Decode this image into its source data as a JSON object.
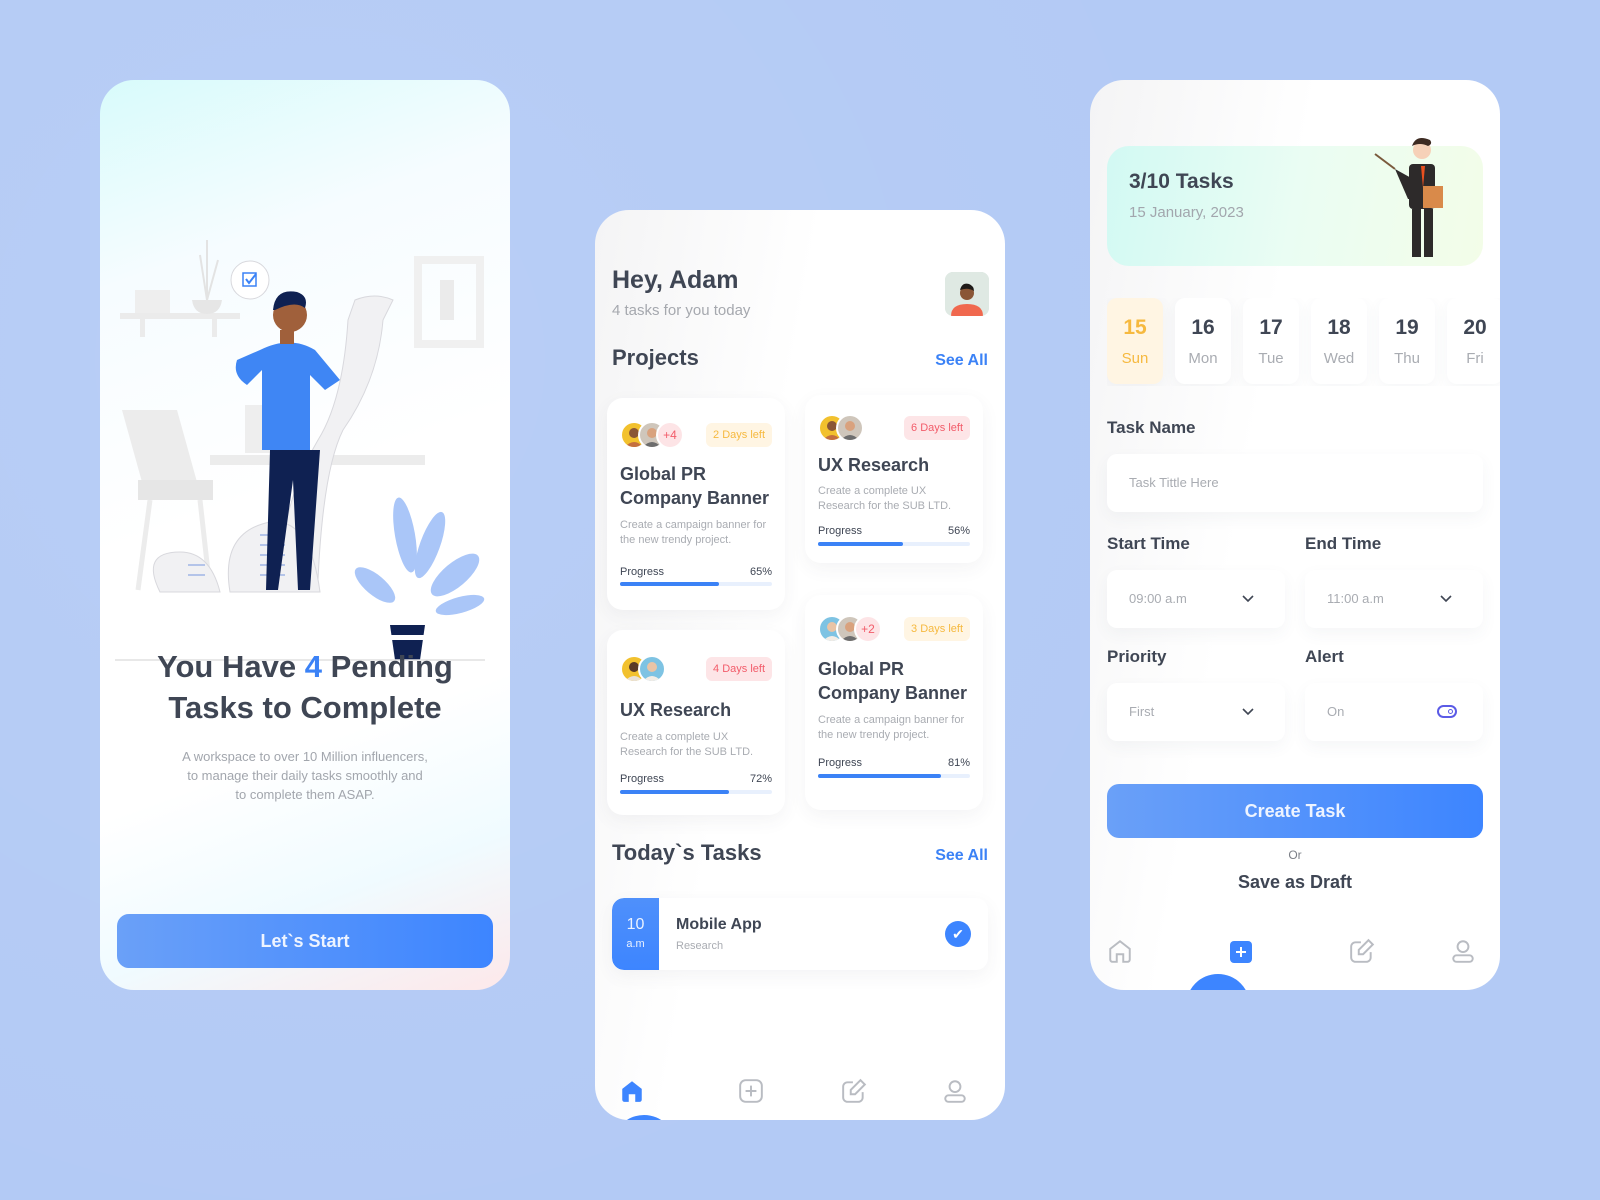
{
  "onboarding": {
    "title_prefix": "You Have",
    "pending_count": "4",
    "title_suffix_line1": "Pending",
    "title_line2": "Tasks to Complete",
    "subtitle_line1": "A workspace to over 10 Million influencers,",
    "subtitle_line2": "to manage their daily tasks smoothly and",
    "subtitle_line3": "to complete them ASAP.",
    "start_button": "Let`s Start",
    "illustration": "person-reading-task-list-illustration"
  },
  "home": {
    "greeting": "Hey, Adam",
    "tasks_today": "4 tasks for you today",
    "projects_title": "Projects",
    "projects_see_all": "See All",
    "projects": [
      {
        "title": "Global PR Company Banner",
        "description": "Create a campaign banner for the new trendy project.",
        "deadline": "2 Days left",
        "deadline_color": "#f6b93f",
        "extra_members": "+4",
        "progress_label": "Progress",
        "progress": 65,
        "progress_text": "65%"
      },
      {
        "title": "UX Research",
        "description": "Create a complete UX Research for the SUB LTD.",
        "deadline": "6 Days left",
        "deadline_color": "#f25c6a",
        "extra_members": "",
        "progress_label": "Progress",
        "progress": 56,
        "progress_text": "56%"
      },
      {
        "title": "UX Research",
        "description": "Create a complete UX Research for the SUB LTD.",
        "deadline": "4 Days left",
        "deadline_color": "#f25c6a",
        "extra_members": "",
        "progress_label": "Progress",
        "progress": 72,
        "progress_text": "72%"
      },
      {
        "title": "Global PR Company Banner",
        "description": "Create a campaign banner for the new trendy project.",
        "deadline": "3 Days left",
        "deadline_color": "#f6b93f",
        "extra_members": "+2",
        "progress_label": "Progress",
        "progress": 81,
        "progress_text": "81%"
      }
    ],
    "today_title": "Today`s Tasks",
    "today_see_all": "See All",
    "tasks": [
      {
        "hour": "10",
        "meridiem": "a.m",
        "name": "Mobile App",
        "category": "Research",
        "done": true
      }
    ],
    "nav": [
      "home-icon",
      "add-icon",
      "edit-icon",
      "profile-icon"
    ],
    "nav_active": "home-icon"
  },
  "create": {
    "summary": "3/10 Tasks",
    "date": "15 January, 2023",
    "days": [
      {
        "num": "15",
        "name": "Sun",
        "selected": true
      },
      {
        "num": "16",
        "name": "Mon"
      },
      {
        "num": "17",
        "name": "Tue"
      },
      {
        "num": "18",
        "name": "Wed"
      },
      {
        "num": "19",
        "name": "Thu"
      },
      {
        "num": "20",
        "name": "Fri"
      }
    ],
    "task_name_label": "Task Name",
    "task_name_placeholder": "Task Tittle Here",
    "start_label": "Start Time",
    "start_value": "09:00 a.m",
    "end_label": "End Time",
    "end_value": "11:00 a.m",
    "priority_label": "Priority",
    "priority_value": "First",
    "alert_label": "Alert",
    "alert_value": "On",
    "alert_on": true,
    "create_button": "Create Task",
    "or_text": "Or",
    "draft_button": "Save as Draft",
    "nav": [
      "home-icon",
      "add-icon",
      "edit-icon",
      "profile-icon"
    ],
    "nav_active": "add-icon"
  },
  "colors": {
    "accent": "#3d85ff",
    "warning": "#f6b93f",
    "danger": "#f25c6a",
    "text": "#3f4654",
    "muted": "#a9acb2"
  }
}
